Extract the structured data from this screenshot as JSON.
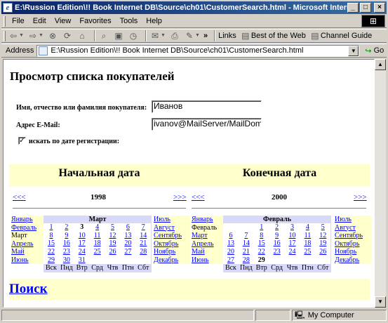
{
  "window": {
    "title": "E:\\Russion Edition\\!! Book Internet DB\\Source\\ch01\\CustomerSearch.html - Microsoft Internet Expl...",
    "min_glyph": "_",
    "max_glyph": "□",
    "close_glyph": "×"
  },
  "menu": [
    "File",
    "Edit",
    "View",
    "Favorites",
    "Tools",
    "Help"
  ],
  "toolbar": {
    "back": "⇦",
    "forward": "⇨",
    "overflow": "»",
    "links_label": "Links",
    "link1": "Best of the Web",
    "link2": "Channel Guide"
  },
  "address": {
    "label": "Address",
    "url": "E:\\Russion Edition\\!! Book Internet DB\\Source\\ch01\\CustomerSearch.html",
    "go": "Go"
  },
  "status": {
    "zone": "My Computer"
  },
  "page": {
    "title": "Просмотр списка покупателей",
    "name_label": "Имя, отчество или фамилия покупателя:",
    "name_value": "Иванов",
    "email_label": "Адрес E-Mail:",
    "email_value": "ivanov@MailServer/MailDoma",
    "date_check_label": "искать по дате регистрации:",
    "date_check_checked": true,
    "search_link": "Поиск"
  },
  "start": {
    "header": "Начальная дата",
    "prev": "<<<",
    "next": ">>>",
    "year": "1998",
    "month_title": "Март",
    "left_months": [
      "Январь",
      "Февраль",
      "Март",
      "Апрель",
      "Май",
      "Июнь"
    ],
    "right_months": [
      "Июль",
      "Август",
      "Сентябрь",
      "Октябрь",
      "Ноябрь",
      "Декабрь"
    ],
    "current_month": "Март",
    "weeks": [
      [
        "1",
        "2",
        "3",
        "4",
        "5",
        "6",
        "7"
      ],
      [
        "8",
        "9",
        "10",
        "11",
        "12",
        "13",
        "14"
      ],
      [
        "15",
        "16",
        "17",
        "18",
        "19",
        "20",
        "21"
      ],
      [
        "22",
        "23",
        "24",
        "25",
        "26",
        "27",
        "28"
      ],
      [
        "29",
        "30",
        "31",
        "",
        "",
        "",
        ""
      ]
    ],
    "selected": "3"
  },
  "end": {
    "header": "Конечная дата",
    "prev": "<<<",
    "next": ">>>",
    "year": "2000",
    "month_title": "Февраль",
    "left_months": [
      "Январь",
      "Февраль",
      "Март",
      "Апрель",
      "Май",
      "Июнь"
    ],
    "right_months": [
      "Июль",
      "Август",
      "Сентябрь",
      "Октябрь",
      "Ноябрь",
      "Декабрь"
    ],
    "current_month": "Февраль",
    "weeks": [
      [
        "",
        "",
        "1",
        "2",
        "3",
        "4",
        "5"
      ],
      [
        "6",
        "7",
        "8",
        "9",
        "10",
        "11",
        "12"
      ],
      [
        "13",
        "14",
        "15",
        "16",
        "17",
        "18",
        "19"
      ],
      [
        "20",
        "21",
        "22",
        "23",
        "24",
        "25",
        "26"
      ],
      [
        "27",
        "28",
        "29",
        "",
        "",
        "",
        ""
      ]
    ],
    "selected": "29"
  },
  "weekdays": [
    "Вск",
    "Пнд",
    "Втр",
    "Срд",
    "Чтв",
    "Птн",
    "Сбт"
  ]
}
